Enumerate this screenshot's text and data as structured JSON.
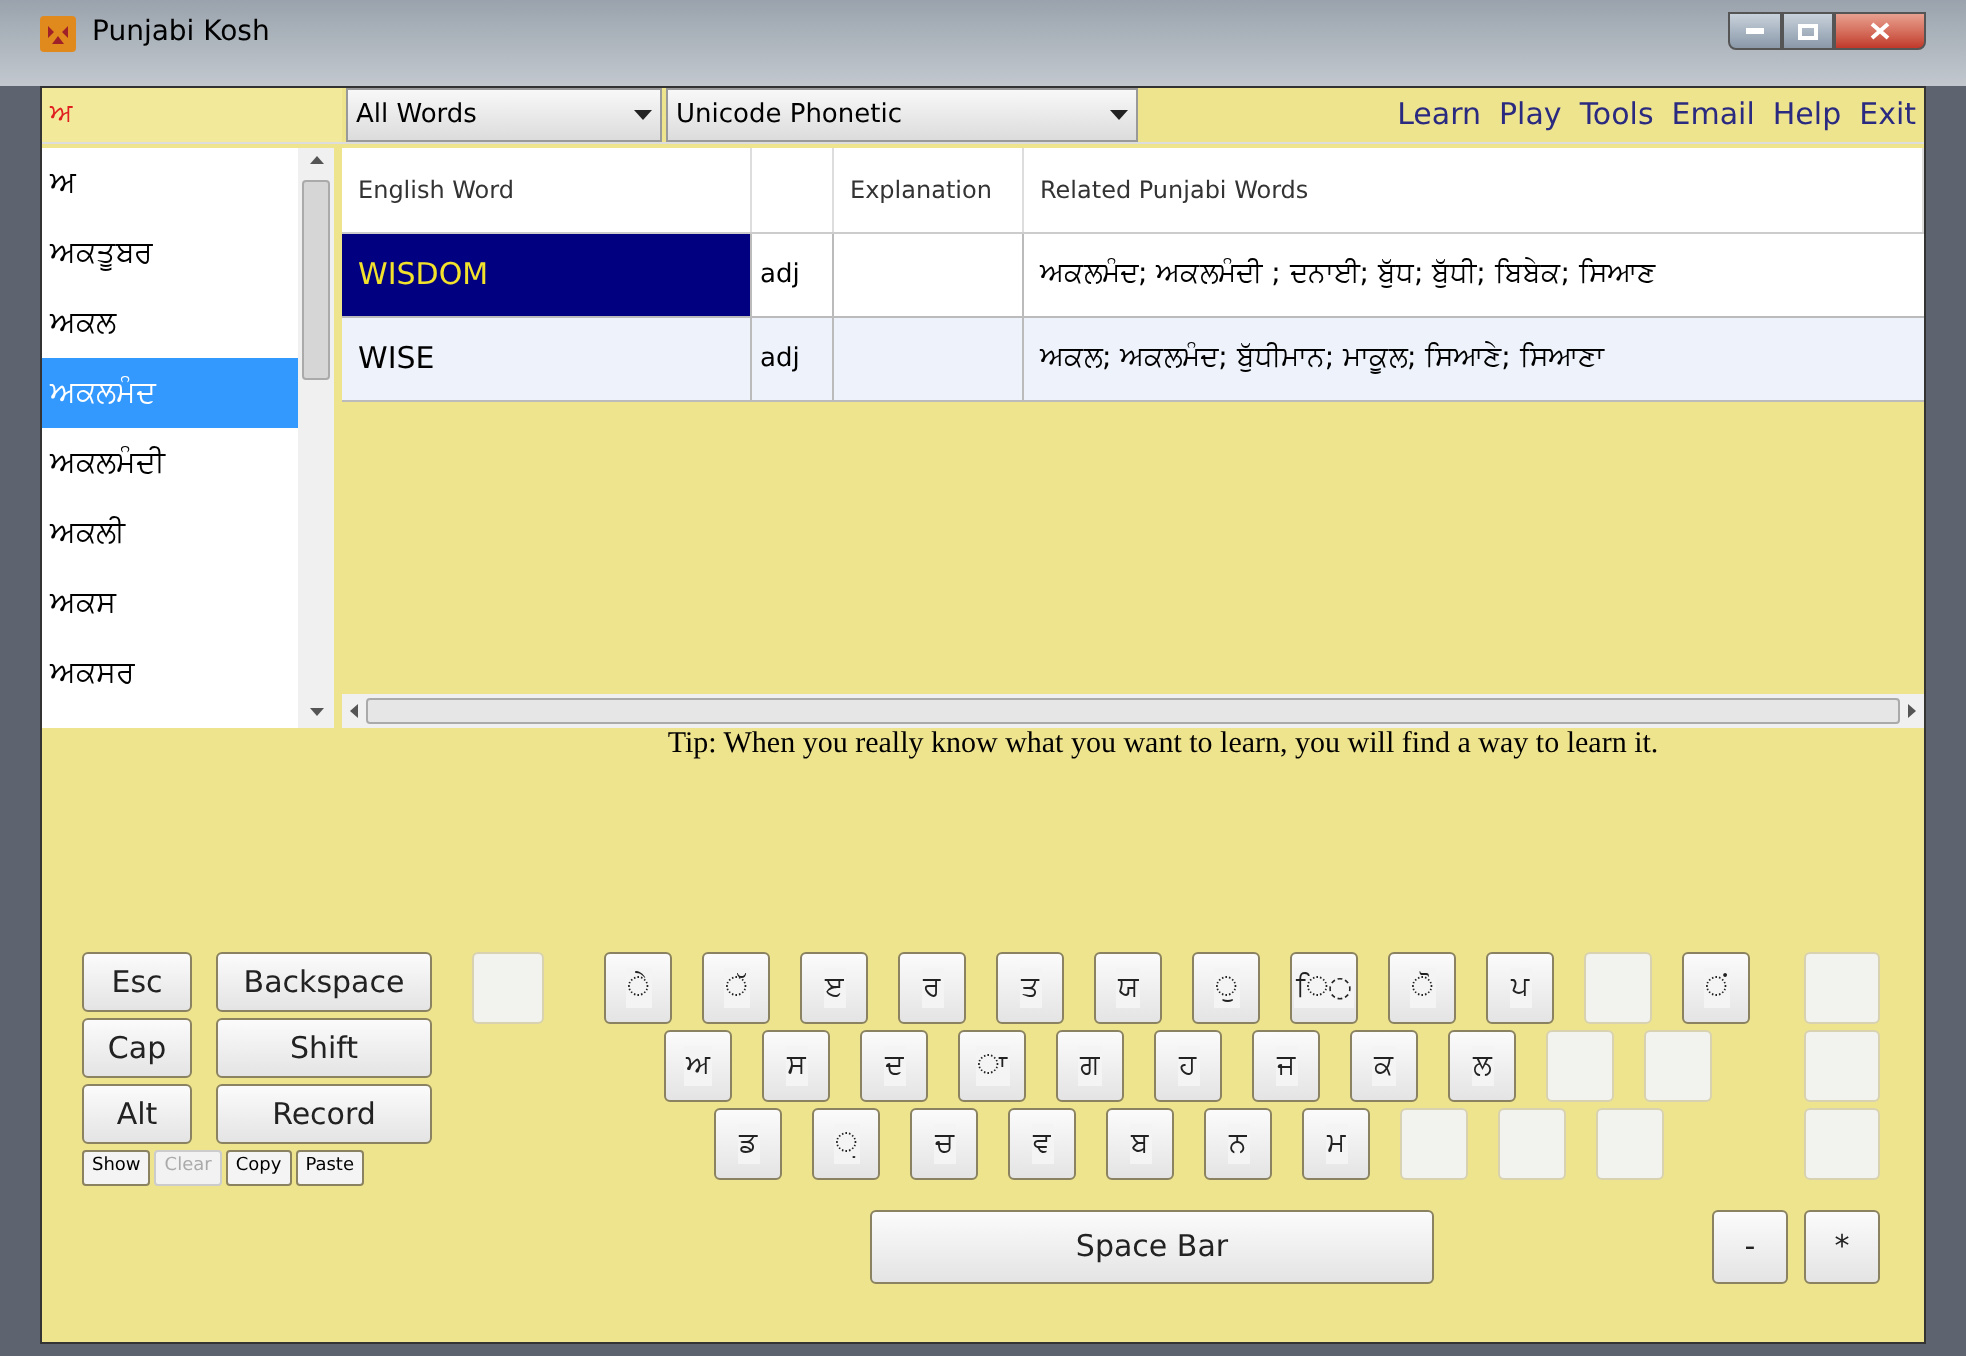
{
  "window": {
    "title": "Punjabi Kosh"
  },
  "search": {
    "value": "ਅ"
  },
  "dropdowns": [
    {
      "value": "All Words"
    },
    {
      "value": "Unicode Phonetic"
    }
  ],
  "menu": [
    "Learn",
    "Play",
    "Tools",
    "Email",
    "Help",
    "Exit"
  ],
  "word_list": [
    {
      "label": "ਅ",
      "selected": false
    },
    {
      "label": "ਅਕਤੂਬਰ",
      "selected": false
    },
    {
      "label": "ਅਕਲ",
      "selected": false
    },
    {
      "label": "ਅਕਲਮੰਦ",
      "selected": true
    },
    {
      "label": "ਅਕਲਮੰਦੀ",
      "selected": false
    },
    {
      "label": "ਅਕਲੀ",
      "selected": false
    },
    {
      "label": "ਅਕਸ",
      "selected": false
    },
    {
      "label": "ਅਕਸਰ",
      "selected": false
    }
  ],
  "table": {
    "columns": [
      {
        "kind": "text",
        "label": "English Word"
      },
      {
        "kind": "blank"
      },
      {
        "kind": "text",
        "label": "Explanation"
      },
      {
        "kind": "text",
        "label": "Related Punjabi Words"
      }
    ],
    "rows": [
      {
        "selected": true,
        "english": "WISDOM",
        "pos": "adj",
        "related": "ਅਕਲਮੰਦ; ਅਕਲਮੰਦੀ ; ਦਨਾਈ; ਬੁੱਧ; ਬੁੱਧੀ; ਬਿਬੇਕ; ਸਿਆਣ"
      },
      {
        "selected": false,
        "english": "WISE",
        "pos": "adj",
        "related": "ਅਕਲ; ਅਕਲਮੰਦ; ਬੁੱਧੀਮਾਨ; ਮਾਕੂਲ; ਸਿਆਣੇ; ਸਿਆਣਾ"
      }
    ]
  },
  "tip": "Tip: When you really know what you want to learn, you will find a way to learn it.",
  "control_keys": [
    [
      "Esc",
      "Backspace"
    ],
    [
      "Cap",
      "Shift"
    ],
    [
      "Alt",
      "Record"
    ]
  ],
  "small_buttons": [
    {
      "label": "Show",
      "disabled": false
    },
    {
      "label": "Clear",
      "disabled": true
    },
    {
      "label": "Copy",
      "disabled": false
    },
    {
      "label": "Paste",
      "disabled": false
    }
  ],
  "key_rows": [
    [
      {
        "kind": "char",
        "label": "◌ੇ"
      },
      {
        "kind": "char",
        "label": "◌ੱ"
      },
      {
        "kind": "char",
        "label": "ੲ"
      },
      {
        "kind": "char",
        "label": "ਰ"
      },
      {
        "kind": "char",
        "label": "ਤ"
      },
      {
        "kind": "char",
        "label": "ਯ"
      },
      {
        "kind": "char",
        "label": "◌ੁ"
      },
      {
        "kind": "char",
        "label": "ਿ◌"
      },
      {
        "kind": "char",
        "label": "◌ੋ"
      },
      {
        "kind": "char",
        "label": "ਪ"
      },
      {
        "kind": "blank"
      },
      {
        "kind": "char",
        "label": "◌ਂ"
      }
    ],
    [
      {
        "kind": "char",
        "label": "ਅ"
      },
      {
        "kind": "char",
        "label": "ਸ"
      },
      {
        "kind": "char",
        "label": "ਦ"
      },
      {
        "kind": "char",
        "label": "◌ਾ"
      },
      {
        "kind": "char",
        "label": "ਗ"
      },
      {
        "kind": "char",
        "label": "ਹ"
      },
      {
        "kind": "char",
        "label": "ਜ"
      },
      {
        "kind": "char",
        "label": "ਕ"
      },
      {
        "kind": "char",
        "label": "ਲ"
      },
      {
        "kind": "blank"
      },
      {
        "kind": "blank"
      }
    ],
    [
      {
        "kind": "char",
        "label": "ਡ"
      },
      {
        "kind": "char",
        "label": "◌਼"
      },
      {
        "kind": "char",
        "label": "ਚ"
      },
      {
        "kind": "char",
        "label": "ਵ"
      },
      {
        "kind": "char",
        "label": "ਬ"
      },
      {
        "kind": "char",
        "label": "ਨ"
      },
      {
        "kind": "char",
        "label": "ਮ"
      },
      {
        "kind": "blank"
      },
      {
        "kind": "blank"
      },
      {
        "kind": "blank"
      }
    ]
  ],
  "space_bar": "Space Bar",
  "bottom_keys": [
    "-",
    "*"
  ]
}
